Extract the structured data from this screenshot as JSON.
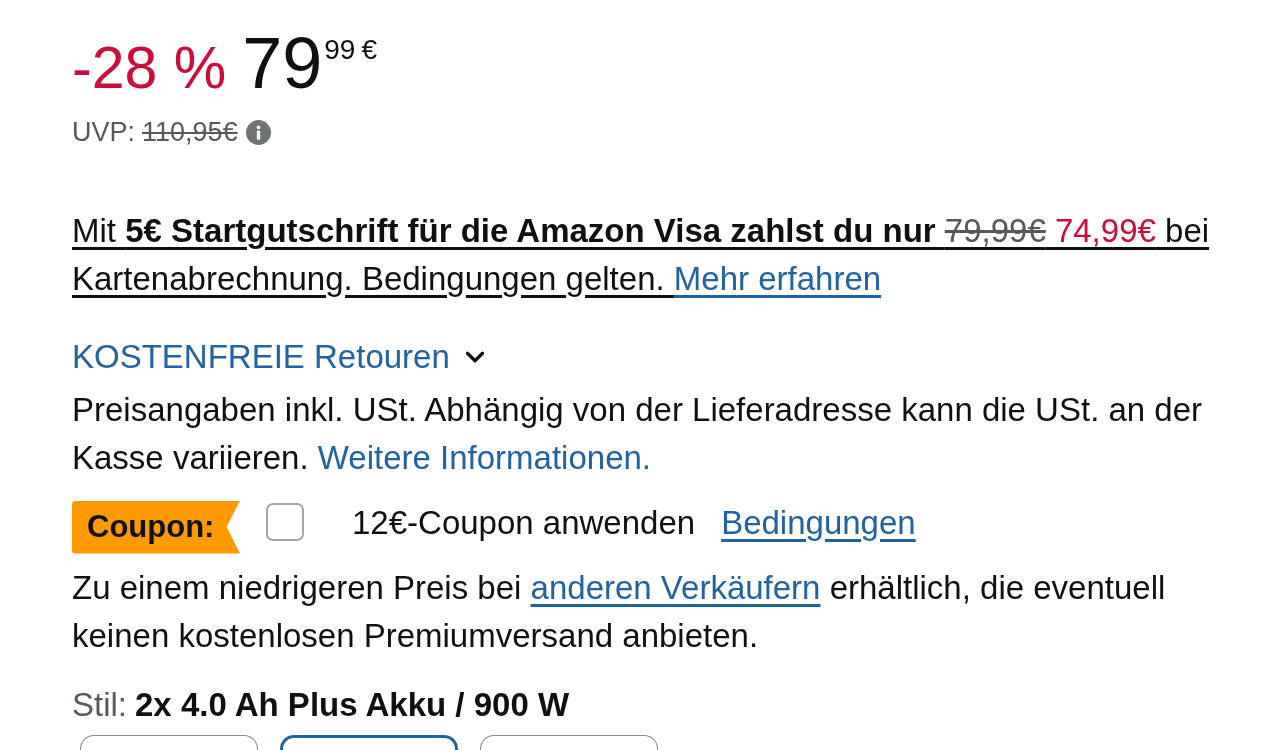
{
  "price": {
    "discount": "-28 %",
    "whole": "79",
    "fraction": "99",
    "currency": "€"
  },
  "list_price": {
    "label": "UVP:",
    "value": "110,95€"
  },
  "visa_offer": {
    "segments": [
      {
        "kind": "text",
        "text": "Mit "
      },
      {
        "kind": "bold",
        "text": "5€ Startgutschrift für die Amazon Visa zahlst du nur "
      },
      {
        "kind": "strike",
        "text": "79,99€"
      },
      {
        "kind": "sale",
        "text": " 74,99€"
      },
      {
        "kind": "text",
        "text": " bei Kartenabrechnung. Bedingungen gelten. "
      },
      {
        "kind": "link",
        "text": "Mehr erfahren"
      }
    ]
  },
  "returns": {
    "label": "KOSTENFREIE Retouren"
  },
  "tax_note": {
    "segments": [
      {
        "kind": "text",
        "text": "Preisangaben inkl. USt. Abhängig von der Lieferadresse kann die USt. an der Kasse variieren. "
      },
      {
        "kind": "link",
        "text": "Weitere Informationen."
      }
    ]
  },
  "coupon": {
    "badge": "Coupon:",
    "checked": false,
    "label": "12€-Coupon anwenden",
    "terms_link": "Bedingungen"
  },
  "other_sellers": {
    "segments": [
      {
        "kind": "text",
        "text": "Zu einem niedrigeren Preis bei "
      },
      {
        "kind": "link",
        "text": "anderen Verkäufern"
      },
      {
        "kind": "text",
        "text": " erhältlich, die eventuell keinen kostenlosen Premiumversand anbieten."
      }
    ]
  },
  "style": {
    "label": "Stil:",
    "value": "2x 4.0 Ah Plus Akku / 900 W",
    "options": [
      {
        "selected": false
      },
      {
        "selected": true
      },
      {
        "selected": false
      }
    ]
  }
}
